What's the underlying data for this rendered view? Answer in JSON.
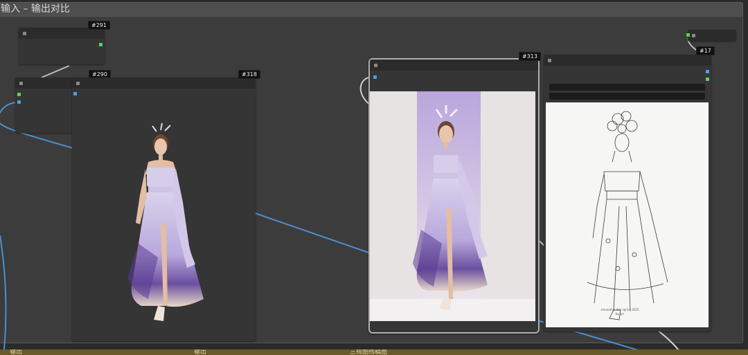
{
  "group": {
    "title": "输入 – 输出对比"
  },
  "nodes": {
    "n291": {
      "badge": "#291"
    },
    "n290": {
      "badge": "#290"
    },
    "n318": {
      "badge": "#318"
    },
    "n313": {
      "badge": "#313"
    },
    "n17": {
      "badge": "#17"
    }
  },
  "sketch_caption": {
    "line1": "simulation dior spring 2025",
    "line2": "by lyn"
  },
  "bottom_tabs": [
    "输出",
    "输出",
    "三视图线稿图"
  ],
  "colors": {
    "wire_blue": "#4a90d0",
    "wire_gray": "#c8c8c8",
    "port_green": "#5dd35d",
    "port_blue": "#4aa0e8",
    "dress_lilac": "#c6bde0",
    "dress_purple": "#6b4fa0",
    "bottom_strip": "#6a5a2a"
  }
}
